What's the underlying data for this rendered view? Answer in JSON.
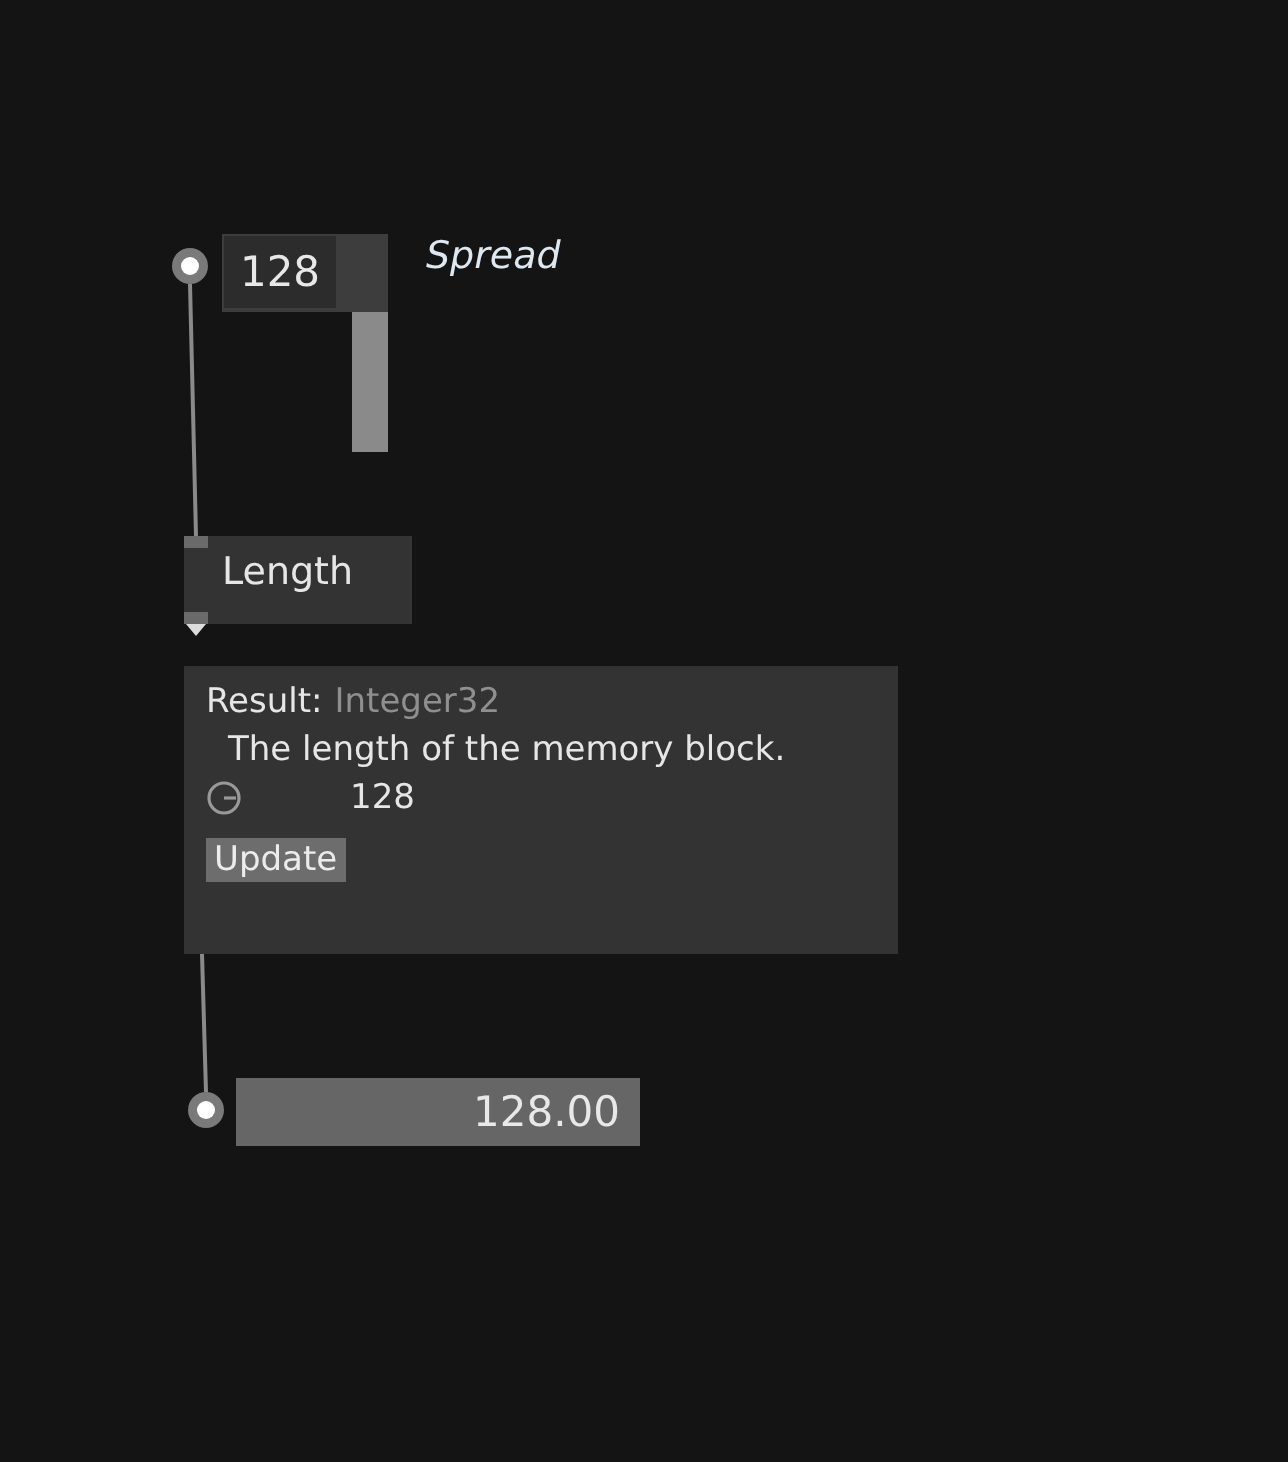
{
  "input_box": {
    "value": "128",
    "label": "Spread"
  },
  "node": {
    "title": "Length"
  },
  "tooltip": {
    "label": "Result:",
    "type": "Integer32",
    "description": "The length of the memory block.",
    "value": "128",
    "button": "Update"
  },
  "output_box": {
    "value": "128.00"
  }
}
